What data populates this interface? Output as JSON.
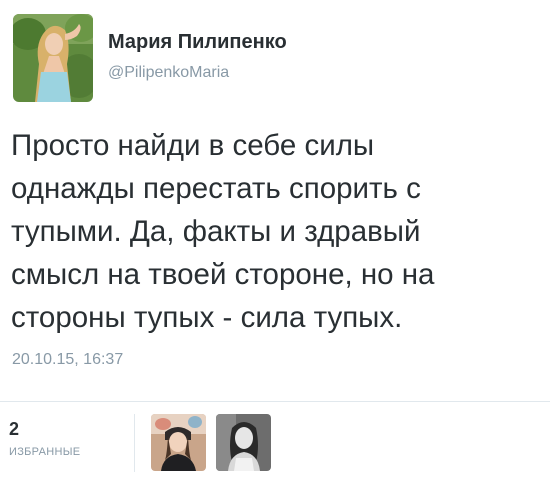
{
  "author": {
    "display_name": "Мария Пилипенко",
    "handle": "@PilipenkoMaria"
  },
  "tweet": {
    "lines": [
      "Просто найди в себе силы",
      "однажды перестать спорить с",
      "тупыми. Да, факты и здравый",
      "смысл на твоей стороне, но на",
      "стороны тупых - сила тупых."
    ],
    "timestamp": "20.10.15, 16:37"
  },
  "stats": {
    "favorites_count": "2",
    "favorites_label": "ИЗБРАННЫЕ"
  },
  "colors": {
    "text": "#292f33",
    "muted": "#8899a6",
    "border": "#e1e8ed"
  }
}
